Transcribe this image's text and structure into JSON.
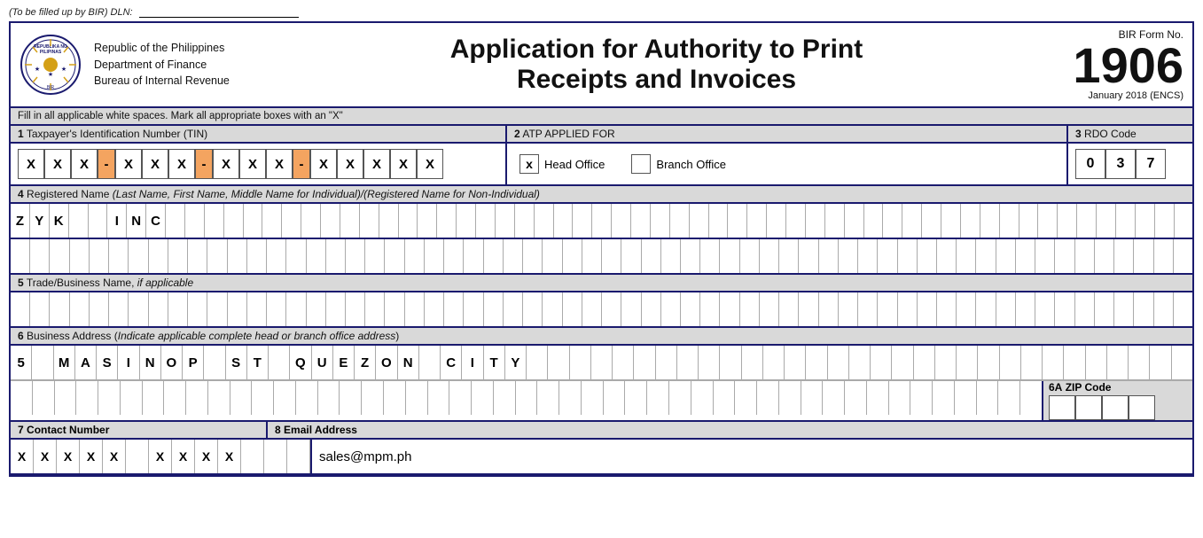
{
  "dln": {
    "instruction": "(To be filled up by BIR)",
    "label": "DLN:"
  },
  "header": {
    "agency_line1": "Republic of the Philippines",
    "agency_line2": "Department of Finance",
    "agency_line3": "Bureau of Internal Revenue",
    "title_line1": "Application for Authority to Print",
    "title_line2": "Receipts and Invoices",
    "form_label": "BIR Form No.",
    "form_number": "1906",
    "form_date": "January 2018 (ENCS)"
  },
  "instruction": "Fill in all applicable white spaces. Mark all appropriate boxes with an \"X\"",
  "section1": {
    "label": "1",
    "title": "Taxpayer's Identification Number (TIN)",
    "tin_digits": [
      "X",
      "X",
      "X",
      "",
      "X",
      "X",
      "X",
      "",
      "X",
      "X",
      "X",
      "",
      "X",
      "X",
      "X",
      "X",
      "X"
    ]
  },
  "section2": {
    "label": "2",
    "title": "ATP APPLIED FOR",
    "head_office_checked": true,
    "branch_office_checked": false,
    "head_office_label": "Head Office",
    "branch_office_label": "Branch Office"
  },
  "section3": {
    "label": "3",
    "title": "RDO Code",
    "digits": [
      "0",
      "3",
      "7"
    ]
  },
  "section4": {
    "label": "4",
    "title": "Registered Name",
    "subtitle": "(Last Name, First Name, Middle Name for Individual)/(Registered Name for Non-Individual)",
    "row1": [
      "Z",
      "Y",
      "K",
      "",
      "",
      "I",
      "N",
      "C",
      "",
      "",
      "",
      "",
      "",
      "",
      "",
      "",
      "",
      "",
      "",
      "",
      "",
      "",
      "",
      "",
      "",
      "",
      "",
      "",
      "",
      "",
      "",
      "",
      "",
      "",
      "",
      "",
      "",
      "",
      "",
      "",
      "",
      "",
      "",
      "",
      "",
      "",
      "",
      "",
      "",
      "",
      "",
      "",
      "",
      "",
      "",
      "",
      "",
      "",
      "",
      "",
      ""
    ],
    "row2": [
      "",
      "",
      "",
      "",
      "",
      "",
      "",
      "",
      "",
      "",
      "",
      "",
      "",
      "",
      "",
      "",
      "",
      "",
      "",
      "",
      "",
      "",
      "",
      "",
      "",
      "",
      "",
      "",
      "",
      "",
      "",
      "",
      "",
      "",
      "",
      "",
      "",
      "",
      "",
      "",
      "",
      "",
      "",
      "",
      "",
      "",
      "",
      "",
      "",
      "",
      "",
      "",
      "",
      "",
      "",
      "",
      "",
      "",
      "",
      ""
    ]
  },
  "section5": {
    "label": "5",
    "title": "Trade/Business Name",
    "subtitle": "if applicable",
    "row1": [
      "",
      "",
      "",
      "",
      "",
      "",
      "",
      "",
      "",
      "",
      "",
      "",
      "",
      "",
      "",
      "",
      "",
      "",
      "",
      "",
      "",
      "",
      "",
      "",
      "",
      "",
      "",
      "",
      "",
      "",
      "",
      "",
      "",
      "",
      "",
      "",
      "",
      "",
      "",
      "",
      "",
      "",
      "",
      "",
      "",
      "",
      "",
      "",
      "",
      "",
      "",
      "",
      "",
      "",
      "",
      "",
      "",
      "",
      "",
      ""
    ]
  },
  "section6": {
    "label": "6",
    "title": "Business Address",
    "subtitle": "Indicate applicable complete head or branch office address",
    "row1": [
      "5",
      "",
      "M",
      "A",
      "S",
      "I",
      "N",
      "O",
      "P",
      "",
      "S",
      "T",
      "",
      "Q",
      "U",
      "E",
      "Z",
      "O",
      "N",
      "",
      "C",
      "I",
      "T",
      "Y",
      "",
      "",
      "",
      "",
      "",
      "",
      "",
      "",
      "",
      "",
      "",
      "",
      "",
      "",
      "",
      "",
      "",
      "",
      "",
      "",
      "",
      "",
      "",
      "",
      "",
      "",
      "",
      "",
      "",
      "",
      ""
    ],
    "row2": [
      "",
      "",
      "",
      "",
      "",
      "",
      "",
      "",
      "",
      "",
      "",
      "",
      "",
      "",
      "",
      "",
      "",
      "",
      "",
      "",
      "",
      "",
      "",
      "",
      "",
      "",
      "",
      "",
      "",
      "",
      "",
      "",
      "",
      "",
      "",
      "",
      "",
      "",
      "",
      "",
      "",
      "",
      "",
      "",
      "",
      "",
      ""
    ],
    "zip_label": "6A",
    "zip_title": "ZIP Code",
    "zip_boxes": [
      "",
      "",
      "",
      ""
    ]
  },
  "section7": {
    "label": "7",
    "title": "Contact Number",
    "digits": [
      "X",
      "X",
      "X",
      "X",
      "X",
      "",
      "X",
      "X",
      "X",
      "X",
      "",
      "",
      ""
    ]
  },
  "section8": {
    "label": "8",
    "title": "Email Address",
    "value": "sales@mpm.ph",
    "row": [
      "s",
      "a",
      "l",
      "e",
      "s",
      "@",
      "m",
      "p",
      "m",
      ".",
      "p",
      "h",
      "",
      "",
      "",
      "",
      "",
      "",
      "",
      "",
      "",
      "",
      "",
      "",
      "",
      "",
      "",
      "",
      "",
      "",
      "",
      "",
      "",
      "",
      "",
      "",
      "",
      "",
      "",
      "",
      "",
      "",
      "",
      "",
      "",
      "",
      "",
      "",
      "",
      "",
      "",
      "",
      "",
      "",
      "",
      "",
      "",
      "",
      "",
      ""
    ]
  }
}
